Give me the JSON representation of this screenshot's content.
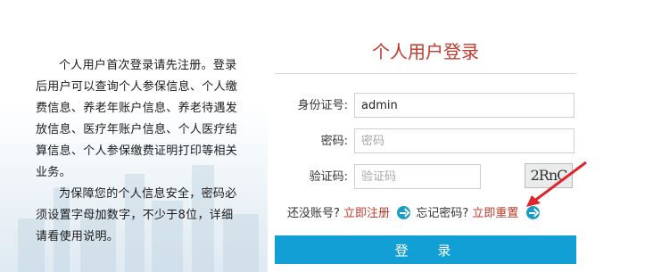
{
  "intro": {
    "paragraph1": "个人用户首次登录请先注册。登录后用户可以查询个人参保信息、个人缴费信息、养老年账户信息、养老待遇发放信息、医疗年账户信息、个人医疗结算信息、个人参保缴费证明打印等相关业务。",
    "paragraph2": "为保障您的个人信息安全，密码必须设置字母加数字，不少于8位，详细请看使用说明。"
  },
  "login": {
    "title": "个人用户登录",
    "id_label": "身份证号:",
    "id_value": "admin",
    "password_label": "密码:",
    "password_placeholder": "密码",
    "captcha_label": "验证码:",
    "captcha_placeholder": "验证码",
    "captcha_text": "2RnC",
    "no_account_text": "还没账号?",
    "register_link": "立即注册",
    "forgot_text": "忘记密码?",
    "reset_link": "立即重置",
    "submit_label": "登 录"
  },
  "colors": {
    "accent_red": "#c0392b",
    "button_blue": "#129fd5",
    "arrow_blue": "#1a9cc8"
  }
}
